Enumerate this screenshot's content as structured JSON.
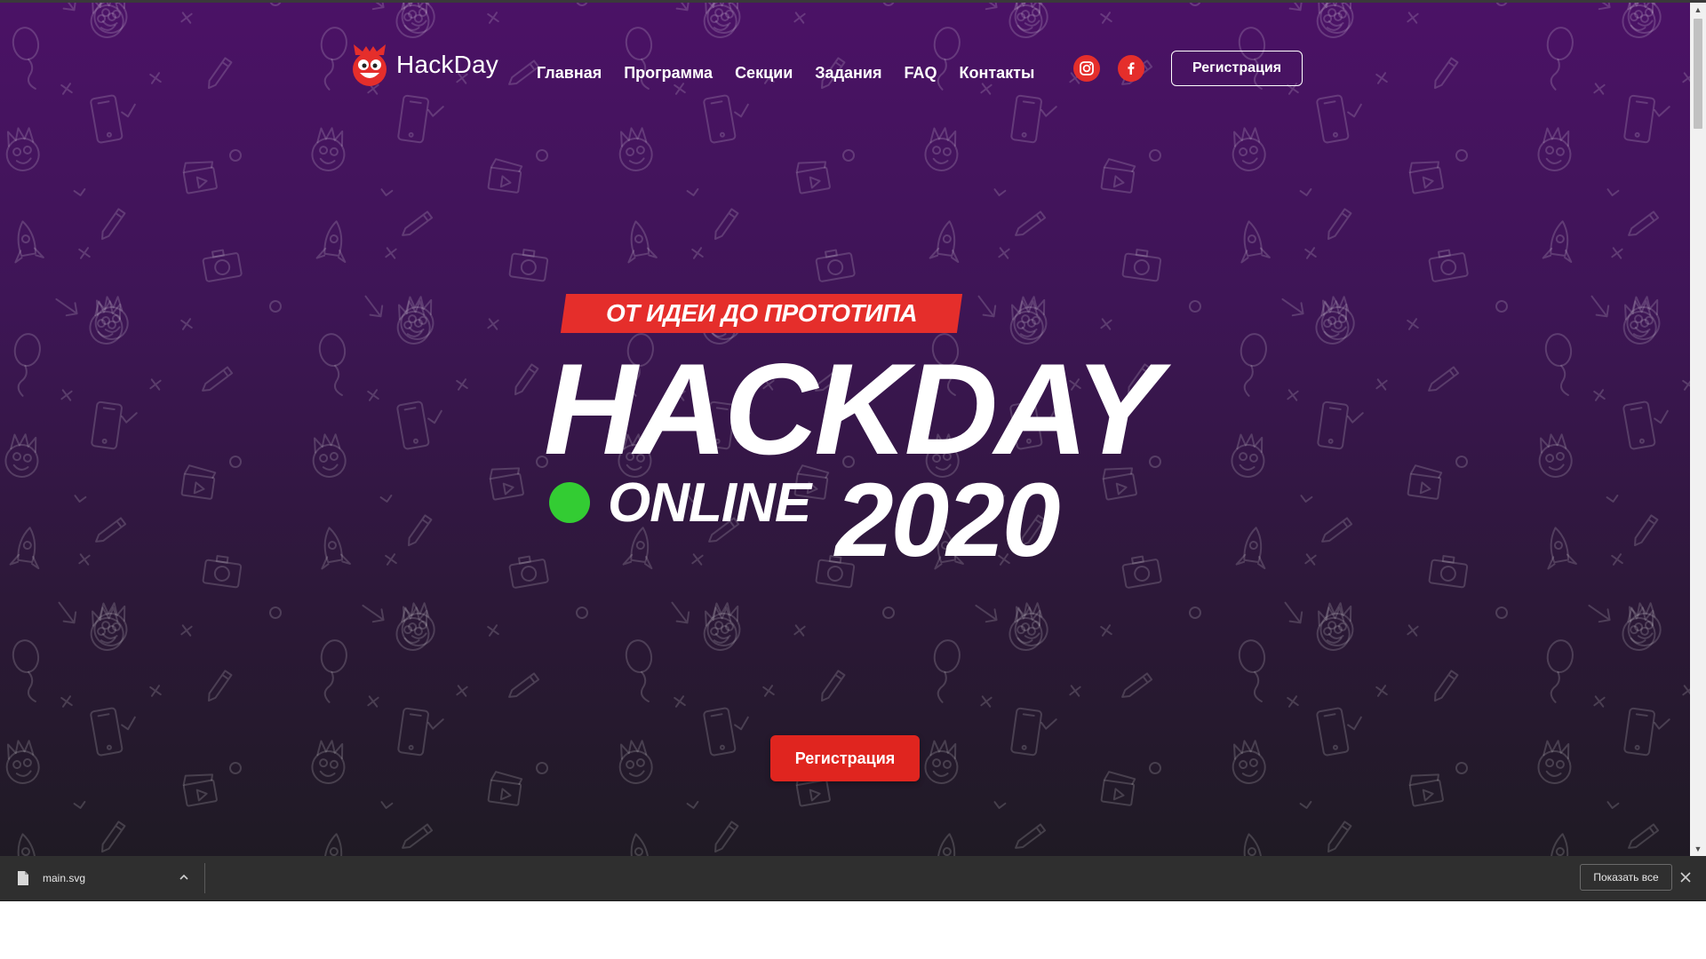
{
  "header": {
    "logo_text": "HackDay",
    "nav": [
      {
        "label": "Главная"
      },
      {
        "label": "Программа"
      },
      {
        "label": "Секции"
      },
      {
        "label": "Задания"
      },
      {
        "label": "FAQ"
      },
      {
        "label": "Контакты"
      }
    ],
    "social": [
      {
        "icon": "instagram-icon"
      },
      {
        "icon": "facebook-icon"
      }
    ],
    "register_label": "Регистрация"
  },
  "hero": {
    "tagline": "ОТ ИДЕИ ДО ПРОТОТИПА",
    "title": "HACKDAY",
    "online": "ONLINE",
    "year": "2020",
    "register_label": "Регистрация"
  },
  "colors": {
    "accent_red": "#e52e2b",
    "online_dot": "#33cc33",
    "background_top": "#4b1266",
    "background_bottom": "#1f1a24"
  },
  "downloads": {
    "file_name": "main.svg",
    "show_all_label": "Показать все"
  }
}
